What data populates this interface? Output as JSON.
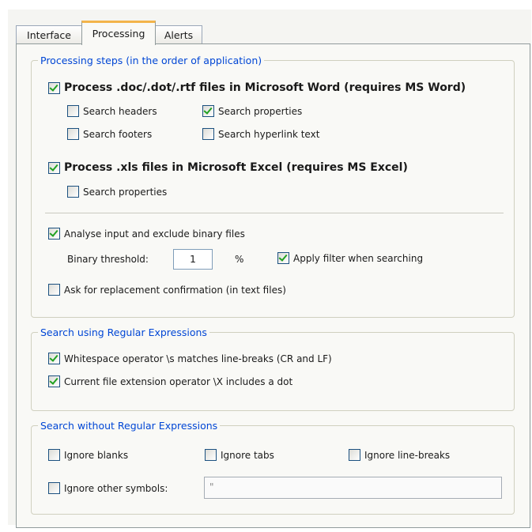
{
  "tabs": [
    "Interface",
    "Processing",
    "Alerts"
  ],
  "processing_group": {
    "legend": "Processing steps (in the order of application)",
    "word": {
      "label": "Process .doc/.dot/.rtf files in Microsoft Word (requires MS Word)",
      "checked": true,
      "options": [
        {
          "label": "Search headers",
          "checked": false
        },
        {
          "label": "Search properties",
          "checked": true
        },
        {
          "label": "Search footers",
          "checked": false
        },
        {
          "label": "Search hyperlink text",
          "checked": false
        }
      ]
    },
    "excel": {
      "label": "Process .xls files in Microsoft Excel (requires MS Excel)",
      "checked": true,
      "options": [
        {
          "label": "Search properties",
          "checked": false
        }
      ]
    },
    "analyse": {
      "label": "Analyse input and exclude binary files",
      "checked": true
    },
    "binary_threshold": {
      "label": "Binary threshold:",
      "value": "1",
      "unit": "%"
    },
    "apply_filter": {
      "label": "Apply filter when searching",
      "checked": true
    },
    "ask_confirm": {
      "label": "Ask for replacement confirmation (in text files)",
      "checked": false
    }
  },
  "regex_group": {
    "legend": "Search using Regular Expressions",
    "whitespace": {
      "label": "Whitespace operator \\s matches line-breaks (CR and LF)",
      "checked": true
    },
    "extension": {
      "label": "Current file extension operator \\X includes a dot",
      "checked": true
    }
  },
  "noregex_group": {
    "legend": "Search without Regular Expressions",
    "ignore_blanks": {
      "label": "Ignore blanks",
      "checked": false
    },
    "ignore_tabs": {
      "label": "Ignore tabs",
      "checked": false
    },
    "ignore_linebreaks": {
      "label": "Ignore line-breaks",
      "checked": false
    },
    "ignore_symbols": {
      "label": "Ignore other symbols:",
      "checked": false
    },
    "symbols_value": "\""
  },
  "colors": {
    "legend_blue": "#0046d5",
    "check_green": "#21a121",
    "active_tab_accent": "#f3b44a"
  }
}
